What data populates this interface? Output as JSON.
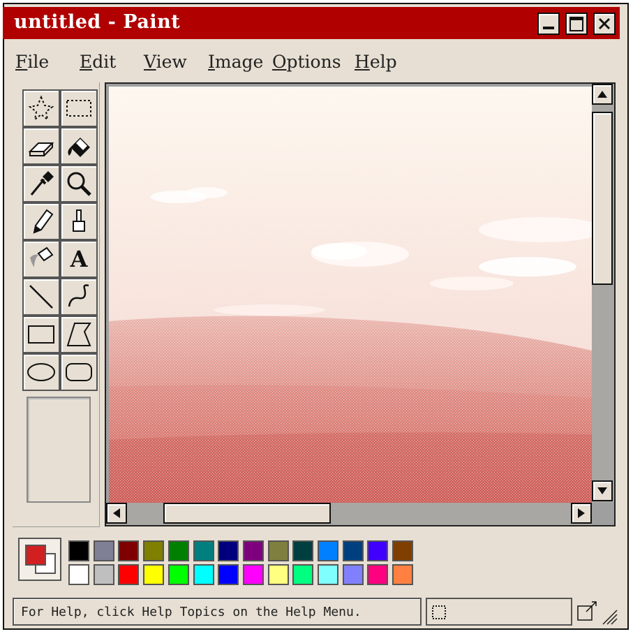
{
  "window": {
    "title": "untitled - Paint",
    "title_color": "#b00000"
  },
  "menu": [
    {
      "label": "File"
    },
    {
      "label": "Edit"
    },
    {
      "label": "View"
    },
    {
      "label": "Image"
    },
    {
      "label": "Options"
    },
    {
      "label": "Help"
    }
  ],
  "tools": [
    "free-form-select-icon",
    "rect-select-icon",
    "eraser-icon",
    "fill-bucket-icon",
    "color-picker-icon",
    "magnifier-icon",
    "pencil-icon",
    "brush-icon",
    "airbrush-icon",
    "text-tool-icon",
    "line-icon",
    "curve-icon",
    "rectangle-icon",
    "polygon-icon",
    "ellipse-icon",
    "rounded-rect-icon"
  ],
  "text_tool_glyph": "A",
  "colors": {
    "foreground": "#d22020",
    "background": "#ffffff",
    "palette_row1": [
      "#000000",
      "#7f7f96",
      "#7f0000",
      "#7f7f00",
      "#007f00",
      "#007f7f",
      "#00007f",
      "#7f007f",
      "#7f7f3f",
      "#003f3f",
      "#0080ff",
      "#003f7f",
      "#4000ff",
      "#7f3f00"
    ],
    "palette_row2": [
      "#ffffff",
      "#bfbfbf",
      "#ff0000",
      "#ffff00",
      "#00ff00",
      "#00ffff",
      "#0000ff",
      "#ff00ff",
      "#ffff80",
      "#00ff80",
      "#80ffff",
      "#8080ff",
      "#ff0080",
      "#ff8040"
    ]
  },
  "status": {
    "text": "For Help, click Help Topics on the Help Menu."
  }
}
